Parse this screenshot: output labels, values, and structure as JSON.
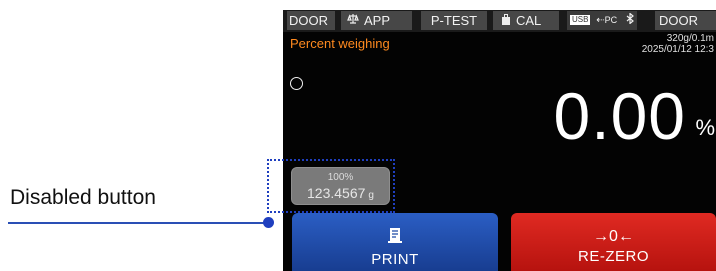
{
  "annotation": {
    "label": "Disabled button"
  },
  "status_bar": {
    "door_left": "DOOR",
    "app": "APP",
    "app_icon": "scale-app-icon",
    "p_test": "P-TEST",
    "cal": "CAL",
    "cal_icon": "weight-cal-icon",
    "usb": "USB",
    "pc": "PC",
    "bluetooth_icon": "bluetooth-icon",
    "door_right": "DOOR"
  },
  "display": {
    "mode_title": "Percent weighing",
    "capacity": "320g/0.1m",
    "datetime": "2025/01/12  12:3",
    "stable_icon": "stable-circle-icon",
    "weight_value": "0.00",
    "weight_unit": "%"
  },
  "reference_button": {
    "percent": "100%",
    "value": "123.4567",
    "unit": "g",
    "enabled": false
  },
  "actions": {
    "print_label": "PRINT",
    "print_icon": "print-icon",
    "rezero_label": "RE-ZERO",
    "rezero_symbol": "→0←"
  },
  "colors": {
    "mode_title": "#ff8a1f",
    "print_button": "#2350b0",
    "rezero_button": "#d01d17",
    "annotation": "#1f3fbf"
  }
}
